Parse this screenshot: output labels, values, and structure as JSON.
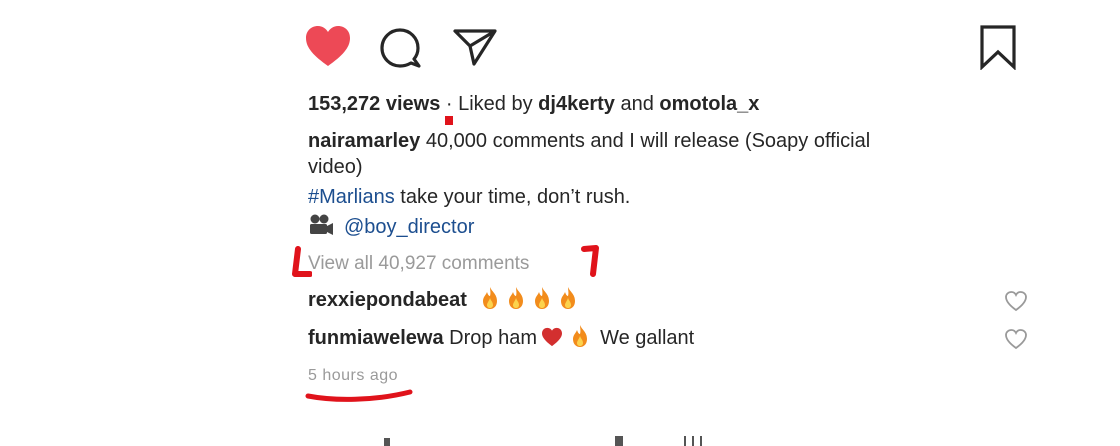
{
  "post": {
    "views": "153,272 views",
    "liked_separator": " · Liked by ",
    "liked_user1": "dj4kerty",
    "liked_and": " and ",
    "liked_user2": "omotola_x",
    "caption_user": "nairamarley",
    "caption_line1": " 40,000 comments and I will release (Soapy official",
    "caption_line2": "video)",
    "hashtag": "#Marlians",
    "caption_line3_rest": " take your time, don’t rush.",
    "director_emoji": "🎥",
    "director_handle": "@boy_director",
    "view_all_comments": "View all 40,927 comments",
    "timestamp": "5 hours ago"
  },
  "comments": [
    {
      "user": "rexxiepondabeat",
      "text": ""
    },
    {
      "user": "funmiawelewa",
      "text_before": " Drop ham",
      "heart_emoji": "❤️",
      "text_after": " We gallant"
    }
  ],
  "colors": {
    "heart_red": "#ed4956",
    "hashtag_blue": "#1c4e8f",
    "annotation_red": "#e0131b",
    "muted_gray": "#9a9a9a"
  },
  "icons": [
    "heart-filled-icon",
    "comment-icon",
    "share-icon",
    "bookmark-icon",
    "fire-icon",
    "heart-outline-icon",
    "video-camera-icon"
  ]
}
